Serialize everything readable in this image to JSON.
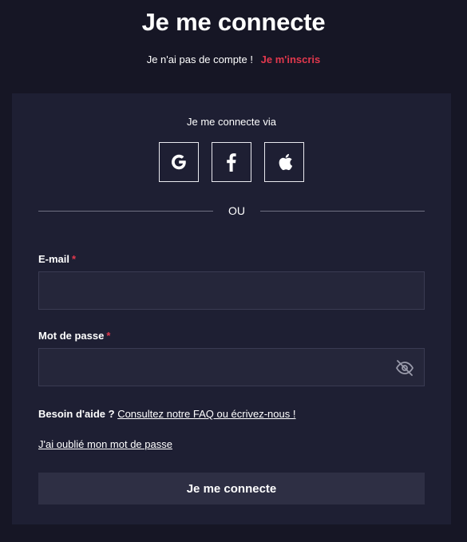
{
  "header": {
    "title": "Je me connecte",
    "no_account_text": "Je n'ai pas de compte !",
    "signup_link": "Je m'inscris"
  },
  "social": {
    "via_text": "Je me connecte via",
    "providers": [
      {
        "name": "google",
        "icon": "google-icon"
      },
      {
        "name": "facebook",
        "icon": "facebook-icon"
      },
      {
        "name": "apple",
        "icon": "apple-icon"
      }
    ],
    "divider_text": "OU"
  },
  "form": {
    "email_label": "E-mail",
    "password_label": "Mot de passe",
    "required_mark": "*",
    "email_value": "",
    "password_value": "",
    "help_prefix": "Besoin d'aide ?",
    "help_link": "Consultez notre FAQ ou écrivez-nous !",
    "forgot_link": "J'ai oublié mon mot de passe",
    "submit_label": "Je me connecte"
  },
  "colors": {
    "background": "#161625",
    "card": "#1e1f33",
    "accent": "#e2384d",
    "input_bg": "#25263a",
    "button_bg": "#2e2f44"
  }
}
